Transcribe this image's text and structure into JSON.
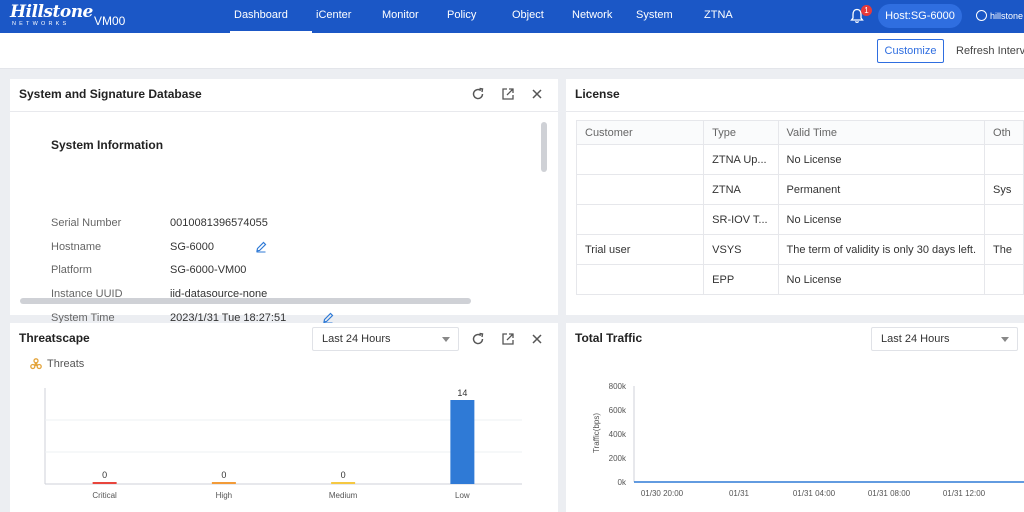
{
  "topbar": {
    "logo_main": "Hillstone",
    "logo_sub": "NETWORKS",
    "device": "VM00",
    "nav": [
      "Dashboard",
      "iCenter",
      "Monitor",
      "Policy",
      "Object",
      "Network",
      "System",
      "ZTNA"
    ],
    "active_nav": "Dashboard",
    "notification_count": "1",
    "host": "Host:SG-6000",
    "user": "hillstone"
  },
  "toolbar": {
    "customize": "Customize",
    "refresh": "Refresh Interval"
  },
  "system_panel": {
    "title": "System and Signature Database",
    "section_title": "System Information",
    "rows": [
      {
        "label": "Serial Number",
        "value": "0010081396574055"
      },
      {
        "label": "Hostname",
        "value": "SG-6000"
      },
      {
        "label": "Platform",
        "value": "SG-6000-VM00"
      },
      {
        "label": "Instance UUID",
        "value": "iid-datasource-none"
      },
      {
        "label": "System Time",
        "value": "2023/1/31 Tue 18:27:51"
      }
    ]
  },
  "license_panel": {
    "title": "License",
    "columns": [
      "Customer",
      "Type",
      "Valid Time",
      "Oth"
    ],
    "rows": [
      [
        "",
        "ZTNA Up...",
        "No License",
        ""
      ],
      [
        "",
        "ZTNA",
        "Permanent",
        "Sys"
      ],
      [
        "",
        "SR-IOV T...",
        "No License",
        ""
      ],
      [
        "Trial user",
        "VSYS",
        "The term of validity is only 30 days left.",
        "The"
      ],
      [
        "",
        "EPP",
        "No License",
        ""
      ]
    ]
  },
  "threatscape_panel": {
    "title": "Threatscape",
    "range": "Last 24 Hours",
    "legend": "Threats"
  },
  "traffic_panel": {
    "title": "Total Traffic",
    "range": "Last 24 Hours"
  },
  "chart_data": [
    {
      "type": "bar",
      "categories": [
        "Critical",
        "High",
        "Medium",
        "Low"
      ],
      "values": [
        0,
        0,
        0,
        14
      ],
      "colors": [
        "#e8453c",
        "#f29b38",
        "#f5c842",
        "#2f7ad6"
      ],
      "ylim": [
        0,
        16
      ],
      "grid": true,
      "legend": "Threats"
    },
    {
      "type": "line",
      "ylabel": "Traffic(bps)",
      "y_ticks": [
        "800k",
        "600k",
        "400k",
        "200k",
        "0k"
      ],
      "y_tick_values": [
        800000,
        600000,
        400000,
        200000,
        0
      ],
      "x_ticks": [
        "01/30 20:00",
        "01/31",
        "01/31 04:00",
        "01/31 08:00",
        "01/31 12:00"
      ],
      "ylim": [
        0,
        800000
      ],
      "series": [
        {
          "values": [
            0,
            0,
            0,
            0,
            0
          ]
        }
      ],
      "color": "#2f7ad6"
    }
  ]
}
